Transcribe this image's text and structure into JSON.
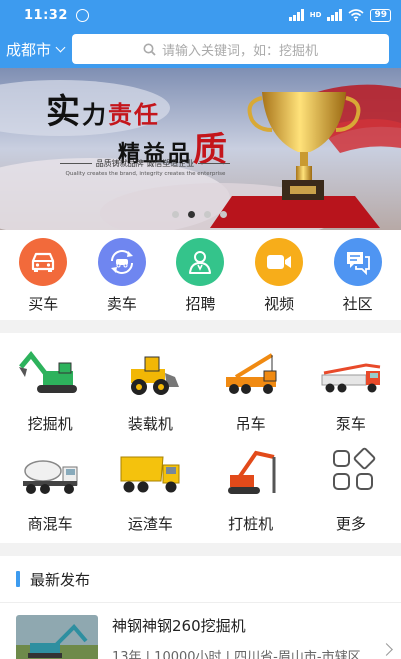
{
  "status_bar": {
    "time": "11:32",
    "signal_type": "HD",
    "battery": "99"
  },
  "header": {
    "city": "成都市",
    "search": {
      "placeholder": "请输入关键词，如：挖掘机"
    }
  },
  "banner": {
    "line1_a": "实",
    "line1_b": "力",
    "line1_c": "责任",
    "line2_a": "精益品",
    "line2_b": "质",
    "subtitle": "品质铸就品牌  诚信塑造企业",
    "subtitle_en": "Quality creates the brand, integrity creates the enterprise",
    "slides": 4,
    "active_slide": 2
  },
  "quick_nav": [
    {
      "label": "买车",
      "icon": "car-icon",
      "color": "#f26a3b"
    },
    {
      "label": "卖车",
      "icon": "car-exchange-icon",
      "color": "#6f86f0"
    },
    {
      "label": "招聘",
      "icon": "person-icon",
      "color": "#34c48b"
    },
    {
      "label": "视频",
      "icon": "video-camera-icon",
      "color": "#f7ad1a"
    },
    {
      "label": "社区",
      "icon": "chat-icon",
      "color": "#4f95f2"
    }
  ],
  "categories": [
    {
      "label": "挖掘机",
      "icon": "excavator-icon"
    },
    {
      "label": "装载机",
      "icon": "loader-icon"
    },
    {
      "label": "吊车",
      "icon": "crane-icon"
    },
    {
      "label": "泵车",
      "icon": "pump-truck-icon"
    },
    {
      "label": "商混车",
      "icon": "mixer-truck-icon"
    },
    {
      "label": "运渣车",
      "icon": "dump-truck-icon"
    },
    {
      "label": "打桩机",
      "icon": "pile-driver-icon"
    },
    {
      "label": "更多",
      "icon": "more-grid-icon"
    }
  ],
  "latest": {
    "title": "最新发布",
    "items": [
      {
        "title": "神钢神钢260挖掘机",
        "meta": "13年 | 10000小时 | 四川省-眉山市-市辖区"
      }
    ]
  },
  "colors": {
    "primary": "#3d9bef",
    "slogan_red": "#c4151b"
  }
}
